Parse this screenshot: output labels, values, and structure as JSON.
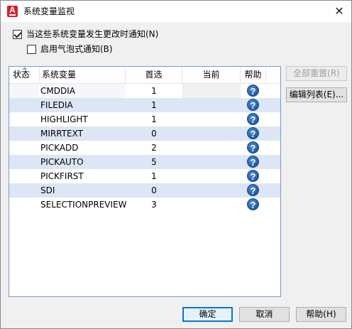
{
  "window": {
    "title": "系统变量监视",
    "close_glyph": "✕",
    "app_icon_letter": "A"
  },
  "options": {
    "notify_label": "当这些系统变量发生更改时通知(N)",
    "notify_checked": true,
    "balloon_label": "启用气泡式通知(B)",
    "balloon_checked": false
  },
  "table": {
    "headers": {
      "status": "状态",
      "name": "系统变量",
      "preferred": "首选",
      "current": "当前",
      "help": "帮助"
    },
    "help_glyph": "?",
    "rows": [
      {
        "name": "CMDDIA",
        "preferred": "1",
        "current": ""
      },
      {
        "name": "FILEDIA",
        "preferred": "1",
        "current": ""
      },
      {
        "name": "HIGHLIGHT",
        "preferred": "1",
        "current": ""
      },
      {
        "name": "MIRRTEXT",
        "preferred": "0",
        "current": ""
      },
      {
        "name": "PICKADD",
        "preferred": "2",
        "current": ""
      },
      {
        "name": "PICKAUTO",
        "preferred": "5",
        "current": ""
      },
      {
        "name": "PICKFIRST",
        "preferred": "1",
        "current": ""
      },
      {
        "name": "SDI",
        "preferred": "0",
        "current": ""
      },
      {
        "name": "SELECTIONPREVIEW",
        "preferred": "3",
        "current": ""
      }
    ]
  },
  "side_buttons": {
    "reset_all": "全部重置(R)",
    "edit_list": "编辑列表(E)..."
  },
  "footer": {
    "ok": "确定",
    "cancel": "取消",
    "help": "帮助(H)"
  },
  "colors": {
    "accent": "#0078d7",
    "alt_row": "#dce6f4",
    "help_icon": "#1f5aa8",
    "app_icon": "#d8202a"
  }
}
